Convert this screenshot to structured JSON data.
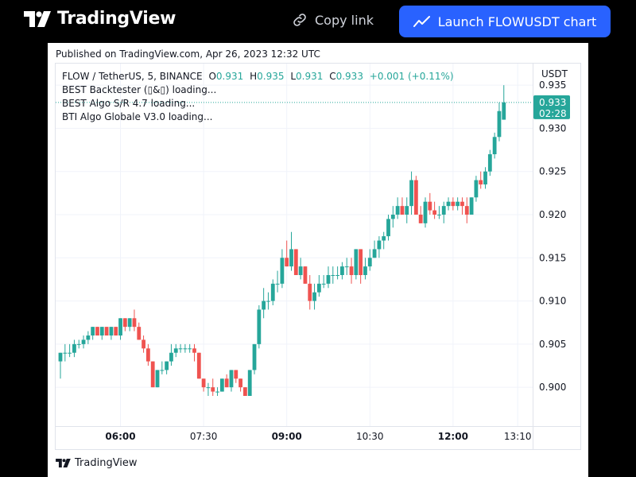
{
  "header": {
    "brand": "TradingView",
    "copy_link_label": "Copy link",
    "launch_label": "Launch FLOWUSDT chart"
  },
  "published": "Published on TradingView.com, Apr 26, 2023 12:32 UTC",
  "legend": {
    "symbol": "FLOW / TetherUS, 5, BINANCE",
    "o_label": "O",
    "o_value": "0.931",
    "h_label": "H",
    "h_value": "0.935",
    "l_label": "L",
    "l_value": "0.931",
    "c_label": "C",
    "c_value": "0.933",
    "change": "+0.001 (+0.11%)",
    "indicators": [
      "BEST Backtester (▯&▯) loading...",
      "BEST Algo S/R 4.7 loading...",
      "BTI Algo Globale V3.0 loading..."
    ]
  },
  "footer_brand": "TradingView",
  "colors": {
    "up": "#26a69a",
    "down": "#ef5350",
    "accent": "#2962ff"
  },
  "chart_data": {
    "type": "candlestick",
    "currency": "USDT",
    "ylim": [
      0.8955,
      0.9375
    ],
    "y_ticks": [
      0.9,
      0.905,
      0.91,
      0.915,
      0.92,
      0.925,
      0.93,
      0.935
    ],
    "y_tick_labels": [
      "0.900",
      "0.905",
      "0.910",
      "0.915",
      "0.920",
      "0.925",
      "0.930",
      "0.935"
    ],
    "x_ticks": [
      {
        "label": "06:00",
        "index": 13,
        "bold": true
      },
      {
        "label": "07:30",
        "index": 31,
        "bold": false
      },
      {
        "label": "09:00",
        "index": 49,
        "bold": true
      },
      {
        "label": "10:30",
        "index": 67,
        "bold": false
      },
      {
        "label": "12:00",
        "index": 85,
        "bold": true
      },
      {
        "label": "13:10",
        "index": 99,
        "bold": false
      }
    ],
    "last_price_label": "0.933",
    "countdown_label": "02:28",
    "last_price": 0.933,
    "candles": [
      [
        0.903,
        0.904,
        0.901,
        0.904
      ],
      [
        0.904,
        0.905,
        0.903,
        0.904
      ],
      [
        0.904,
        0.905,
        0.9035,
        0.904
      ],
      [
        0.904,
        0.9055,
        0.9035,
        0.905
      ],
      [
        0.905,
        0.9055,
        0.9045,
        0.905
      ],
      [
        0.905,
        0.906,
        0.9045,
        0.9055
      ],
      [
        0.9055,
        0.9065,
        0.905,
        0.906
      ],
      [
        0.906,
        0.907,
        0.9055,
        0.907
      ],
      [
        0.907,
        0.907,
        0.906,
        0.906
      ],
      [
        0.906,
        0.907,
        0.9055,
        0.907
      ],
      [
        0.907,
        0.907,
        0.906,
        0.906
      ],
      [
        0.906,
        0.907,
        0.9055,
        0.907
      ],
      [
        0.907,
        0.907,
        0.906,
        0.906
      ],
      [
        0.906,
        0.908,
        0.9055,
        0.908
      ],
      [
        0.908,
        0.908,
        0.9065,
        0.907
      ],
      [
        0.907,
        0.908,
        0.9065,
        0.908
      ],
      [
        0.908,
        0.909,
        0.9065,
        0.907
      ],
      [
        0.907,
        0.9075,
        0.9055,
        0.9055
      ],
      [
        0.9055,
        0.906,
        0.904,
        0.9045
      ],
      [
        0.9045,
        0.905,
        0.9025,
        0.903
      ],
      [
        0.903,
        0.903,
        0.9,
        0.9
      ],
      [
        0.9,
        0.902,
        0.9,
        0.902
      ],
      [
        0.902,
        0.903,
        0.9015,
        0.902
      ],
      [
        0.902,
        0.903,
        0.9015,
        0.903
      ],
      [
        0.903,
        0.905,
        0.9025,
        0.904
      ],
      [
        0.904,
        0.905,
        0.9035,
        0.9045
      ],
      [
        0.9045,
        0.905,
        0.904,
        0.9045
      ],
      [
        0.9045,
        0.905,
        0.904,
        0.9045
      ],
      [
        0.9045,
        0.905,
        0.904,
        0.9045
      ],
      [
        0.9045,
        0.905,
        0.903,
        0.904
      ],
      [
        0.904,
        0.904,
        0.901,
        0.901
      ],
      [
        0.901,
        0.901,
        0.8995,
        0.9
      ],
      [
        0.9,
        0.9005,
        0.899,
        0.9
      ],
      [
        0.9,
        0.901,
        0.899,
        0.8995
      ],
      [
        0.8995,
        0.9,
        0.899,
        0.8995
      ],
      [
        0.8995,
        0.901,
        0.8995,
        0.901
      ],
      [
        0.901,
        0.9015,
        0.9,
        0.9
      ],
      [
        0.9,
        0.902,
        0.8995,
        0.902
      ],
      [
        0.902,
        0.902,
        0.9005,
        0.901
      ],
      [
        0.901,
        0.901,
        0.8995,
        0.9
      ],
      [
        0.9,
        0.9,
        0.899,
        0.899
      ],
      [
        0.899,
        0.902,
        0.899,
        0.902
      ],
      [
        0.902,
        0.905,
        0.9015,
        0.905
      ],
      [
        0.905,
        0.9095,
        0.9045,
        0.909
      ],
      [
        0.909,
        0.9115,
        0.908,
        0.91
      ],
      [
        0.91,
        0.911,
        0.909,
        0.91
      ],
      [
        0.91,
        0.9125,
        0.9095,
        0.912
      ],
      [
        0.912,
        0.9135,
        0.911,
        0.912
      ],
      [
        0.912,
        0.916,
        0.9115,
        0.915
      ],
      [
        0.915,
        0.917,
        0.914,
        0.914
      ],
      [
        0.914,
        0.918,
        0.9135,
        0.916
      ],
      [
        0.916,
        0.916,
        0.913,
        0.913
      ],
      [
        0.913,
        0.915,
        0.9125,
        0.914
      ],
      [
        0.914,
        0.914,
        0.912,
        0.912
      ],
      [
        0.912,
        0.913,
        0.909,
        0.91
      ],
      [
        0.91,
        0.912,
        0.909,
        0.911
      ],
      [
        0.911,
        0.913,
        0.9105,
        0.912
      ],
      [
        0.912,
        0.913,
        0.9115,
        0.912
      ],
      [
        0.912,
        0.914,
        0.9115,
        0.913
      ],
      [
        0.913,
        0.914,
        0.912,
        0.913
      ],
      [
        0.913,
        0.914,
        0.9125,
        0.913
      ],
      [
        0.913,
        0.9145,
        0.9125,
        0.914
      ],
      [
        0.914,
        0.915,
        0.913,
        0.914
      ],
      [
        0.914,
        0.915,
        0.912,
        0.913
      ],
      [
        0.913,
        0.916,
        0.9125,
        0.916
      ],
      [
        0.916,
        0.916,
        0.912,
        0.913
      ],
      [
        0.913,
        0.915,
        0.9125,
        0.914
      ],
      [
        0.914,
        0.916,
        0.9135,
        0.915
      ],
      [
        0.915,
        0.917,
        0.915,
        0.916
      ],
      [
        0.916,
        0.9175,
        0.915,
        0.917
      ],
      [
        0.917,
        0.918,
        0.916,
        0.9175
      ],
      [
        0.9175,
        0.92,
        0.917,
        0.9195
      ],
      [
        0.9195,
        0.921,
        0.9185,
        0.92
      ],
      [
        0.92,
        0.922,
        0.9195,
        0.921
      ],
      [
        0.921,
        0.922,
        0.92,
        0.92
      ],
      [
        0.92,
        0.922,
        0.919,
        0.921
      ],
      [
        0.921,
        0.925,
        0.92,
        0.924
      ],
      [
        0.924,
        0.9245,
        0.92,
        0.92
      ],
      [
        0.92,
        0.921,
        0.919,
        0.919
      ],
      [
        0.919,
        0.922,
        0.9185,
        0.9215
      ],
      [
        0.9215,
        0.9225,
        0.92,
        0.9205
      ],
      [
        0.9205,
        0.9215,
        0.9195,
        0.92
      ],
      [
        0.92,
        0.921,
        0.9195,
        0.92
      ],
      [
        0.92,
        0.9215,
        0.919,
        0.921
      ],
      [
        0.921,
        0.922,
        0.9205,
        0.9215
      ],
      [
        0.9215,
        0.922,
        0.9205,
        0.921
      ],
      [
        0.921,
        0.922,
        0.9205,
        0.9215
      ],
      [
        0.9215,
        0.922,
        0.92,
        0.921
      ],
      [
        0.921,
        0.922,
        0.919,
        0.92
      ],
      [
        0.92,
        0.922,
        0.92,
        0.922
      ],
      [
        0.922,
        0.9245,
        0.9215,
        0.924
      ],
      [
        0.924,
        0.925,
        0.923,
        0.9235
      ],
      [
        0.9235,
        0.9255,
        0.923,
        0.925
      ],
      [
        0.925,
        0.9275,
        0.9245,
        0.927
      ],
      [
        0.927,
        0.9295,
        0.9265,
        0.929
      ],
      [
        0.929,
        0.933,
        0.9285,
        0.932
      ],
      [
        0.931,
        0.935,
        0.931,
        0.933
      ]
    ]
  }
}
